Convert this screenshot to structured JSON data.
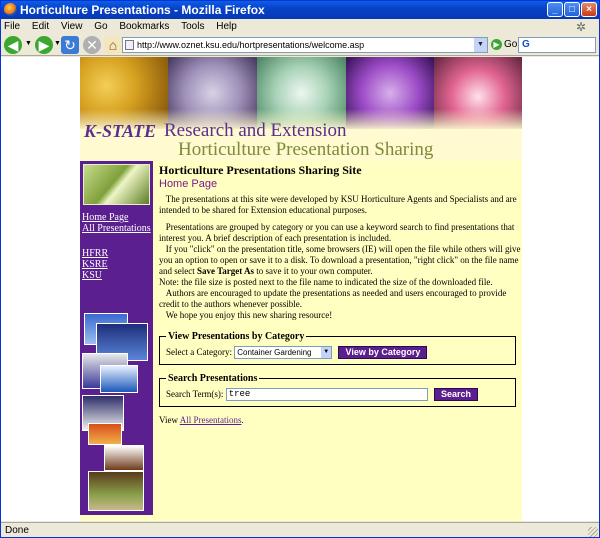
{
  "window": {
    "title": "Horticulture Presentations - Mozilla Firefox",
    "min": "_",
    "max": "□",
    "close": "×"
  },
  "menu": [
    "File",
    "Edit",
    "View",
    "Go",
    "Bookmarks",
    "Tools",
    "Help"
  ],
  "nav": {
    "url": "http://www.oznet.ksu.edu/hortpresentations/welcome.asp",
    "go_label": "Go",
    "search_value": "G"
  },
  "status": "Done",
  "banner": {
    "logo": "K-STATE",
    "line1": "Research and Extension",
    "line2": "Horticulture Presentation Sharing"
  },
  "sidebar": {
    "links": [
      "Home Page",
      "All Presentations"
    ],
    "links2": [
      "HFRR",
      "KSRE",
      "KSU"
    ]
  },
  "main": {
    "title": "Horticulture Presentations Sharing Site",
    "subtitle": "Home Page",
    "p1": "The presentations at this site were developed by KSU Horticulture Agents and Specialists and are intended to be shared for Extension educational purposes.",
    "p2": "Presentations are grouped by category or you can use a keyword search to find presentations that interest you. A brief description of each presentation is included.",
    "p3a": "If you \"click\" on the presentation title, some browsers (IE) will open the file while others will give you an option to open or save it to a disk. To download a presentation, \"right click\" on the file name and select ",
    "p3b": "Save Target As",
    "p3c": " to save it to your own computer.",
    "p4": "Note: the file size is posted next to the file name to indicated the size of the downloaded file.",
    "p5": "Authors are encouraged to update the presentations as needed and users encouraged to provide credit to the authors whenever possible.",
    "p6": "We hope you enjoy this new sharing resource!",
    "category": {
      "legend": "View Presentations by Category",
      "label": "Select a Category:",
      "selected": "Container Gardening",
      "button": "View by Category"
    },
    "search": {
      "legend": "Search Presentations",
      "label": "Search Term(s):",
      "value": "tree",
      "button": "Search"
    },
    "view_prefix": "View ",
    "view_link": "All Presentations",
    "view_suffix": "."
  }
}
